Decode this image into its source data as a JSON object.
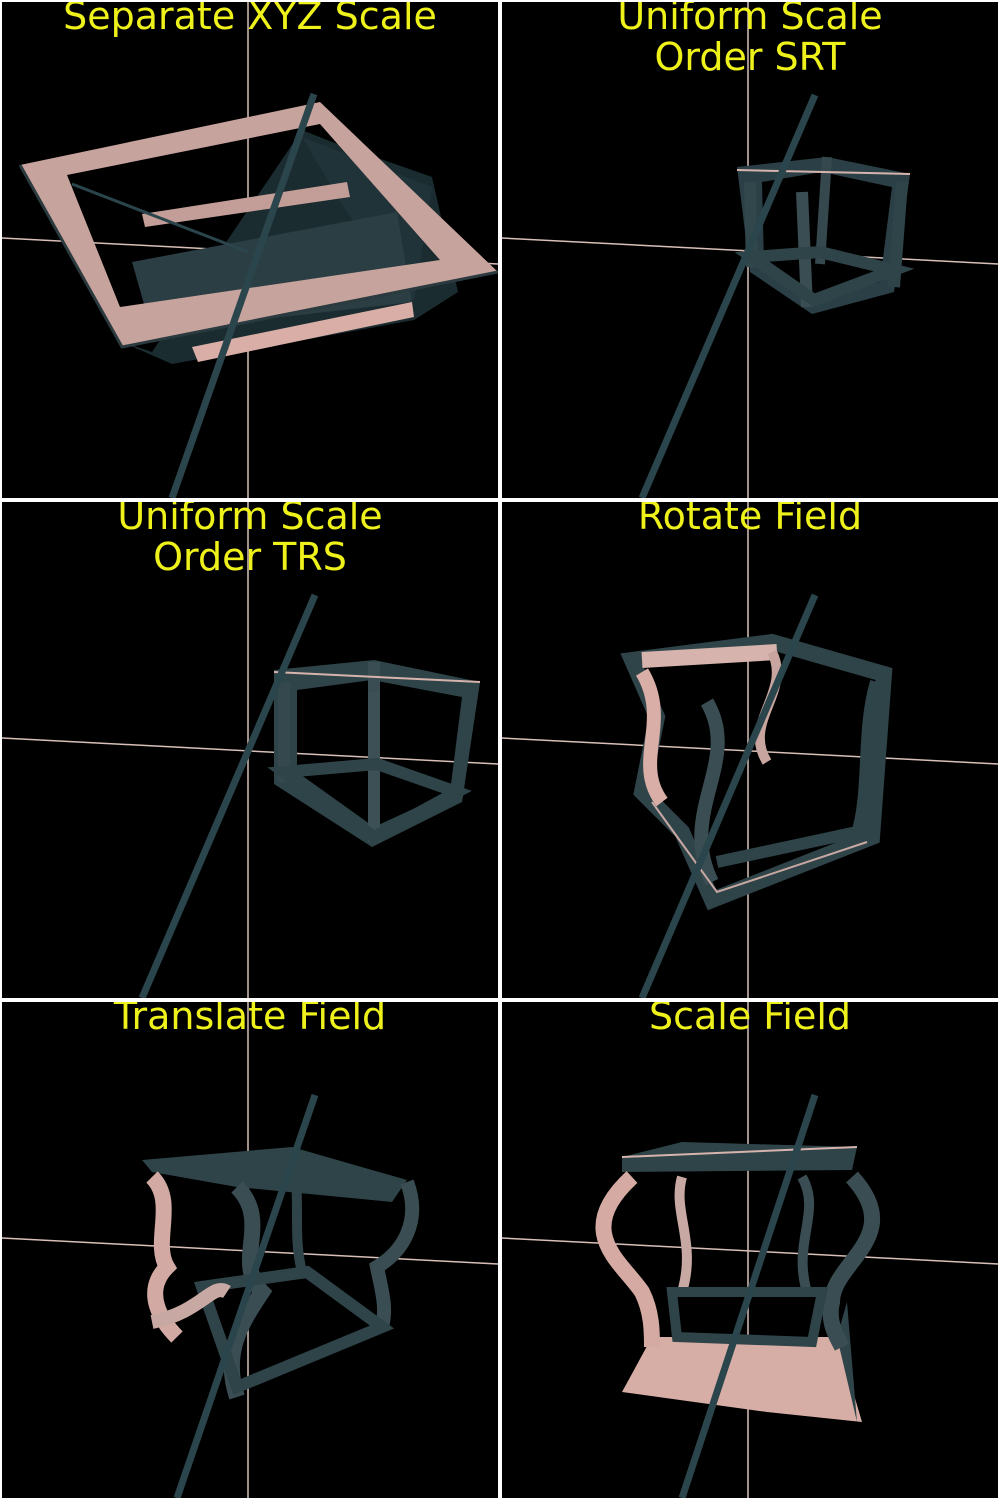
{
  "accent_title_color": "#eef21a",
  "background_color": "#000000",
  "panels": [
    {
      "title": "Separate XYZ Scale"
    },
    {
      "title": "Uniform Scale\nOrder SRT"
    },
    {
      "title": "Uniform Scale\nOrder TRS"
    },
    {
      "title": "Rotate Field"
    },
    {
      "title": "Translate Field"
    },
    {
      "title": "Scale Field"
    }
  ]
}
